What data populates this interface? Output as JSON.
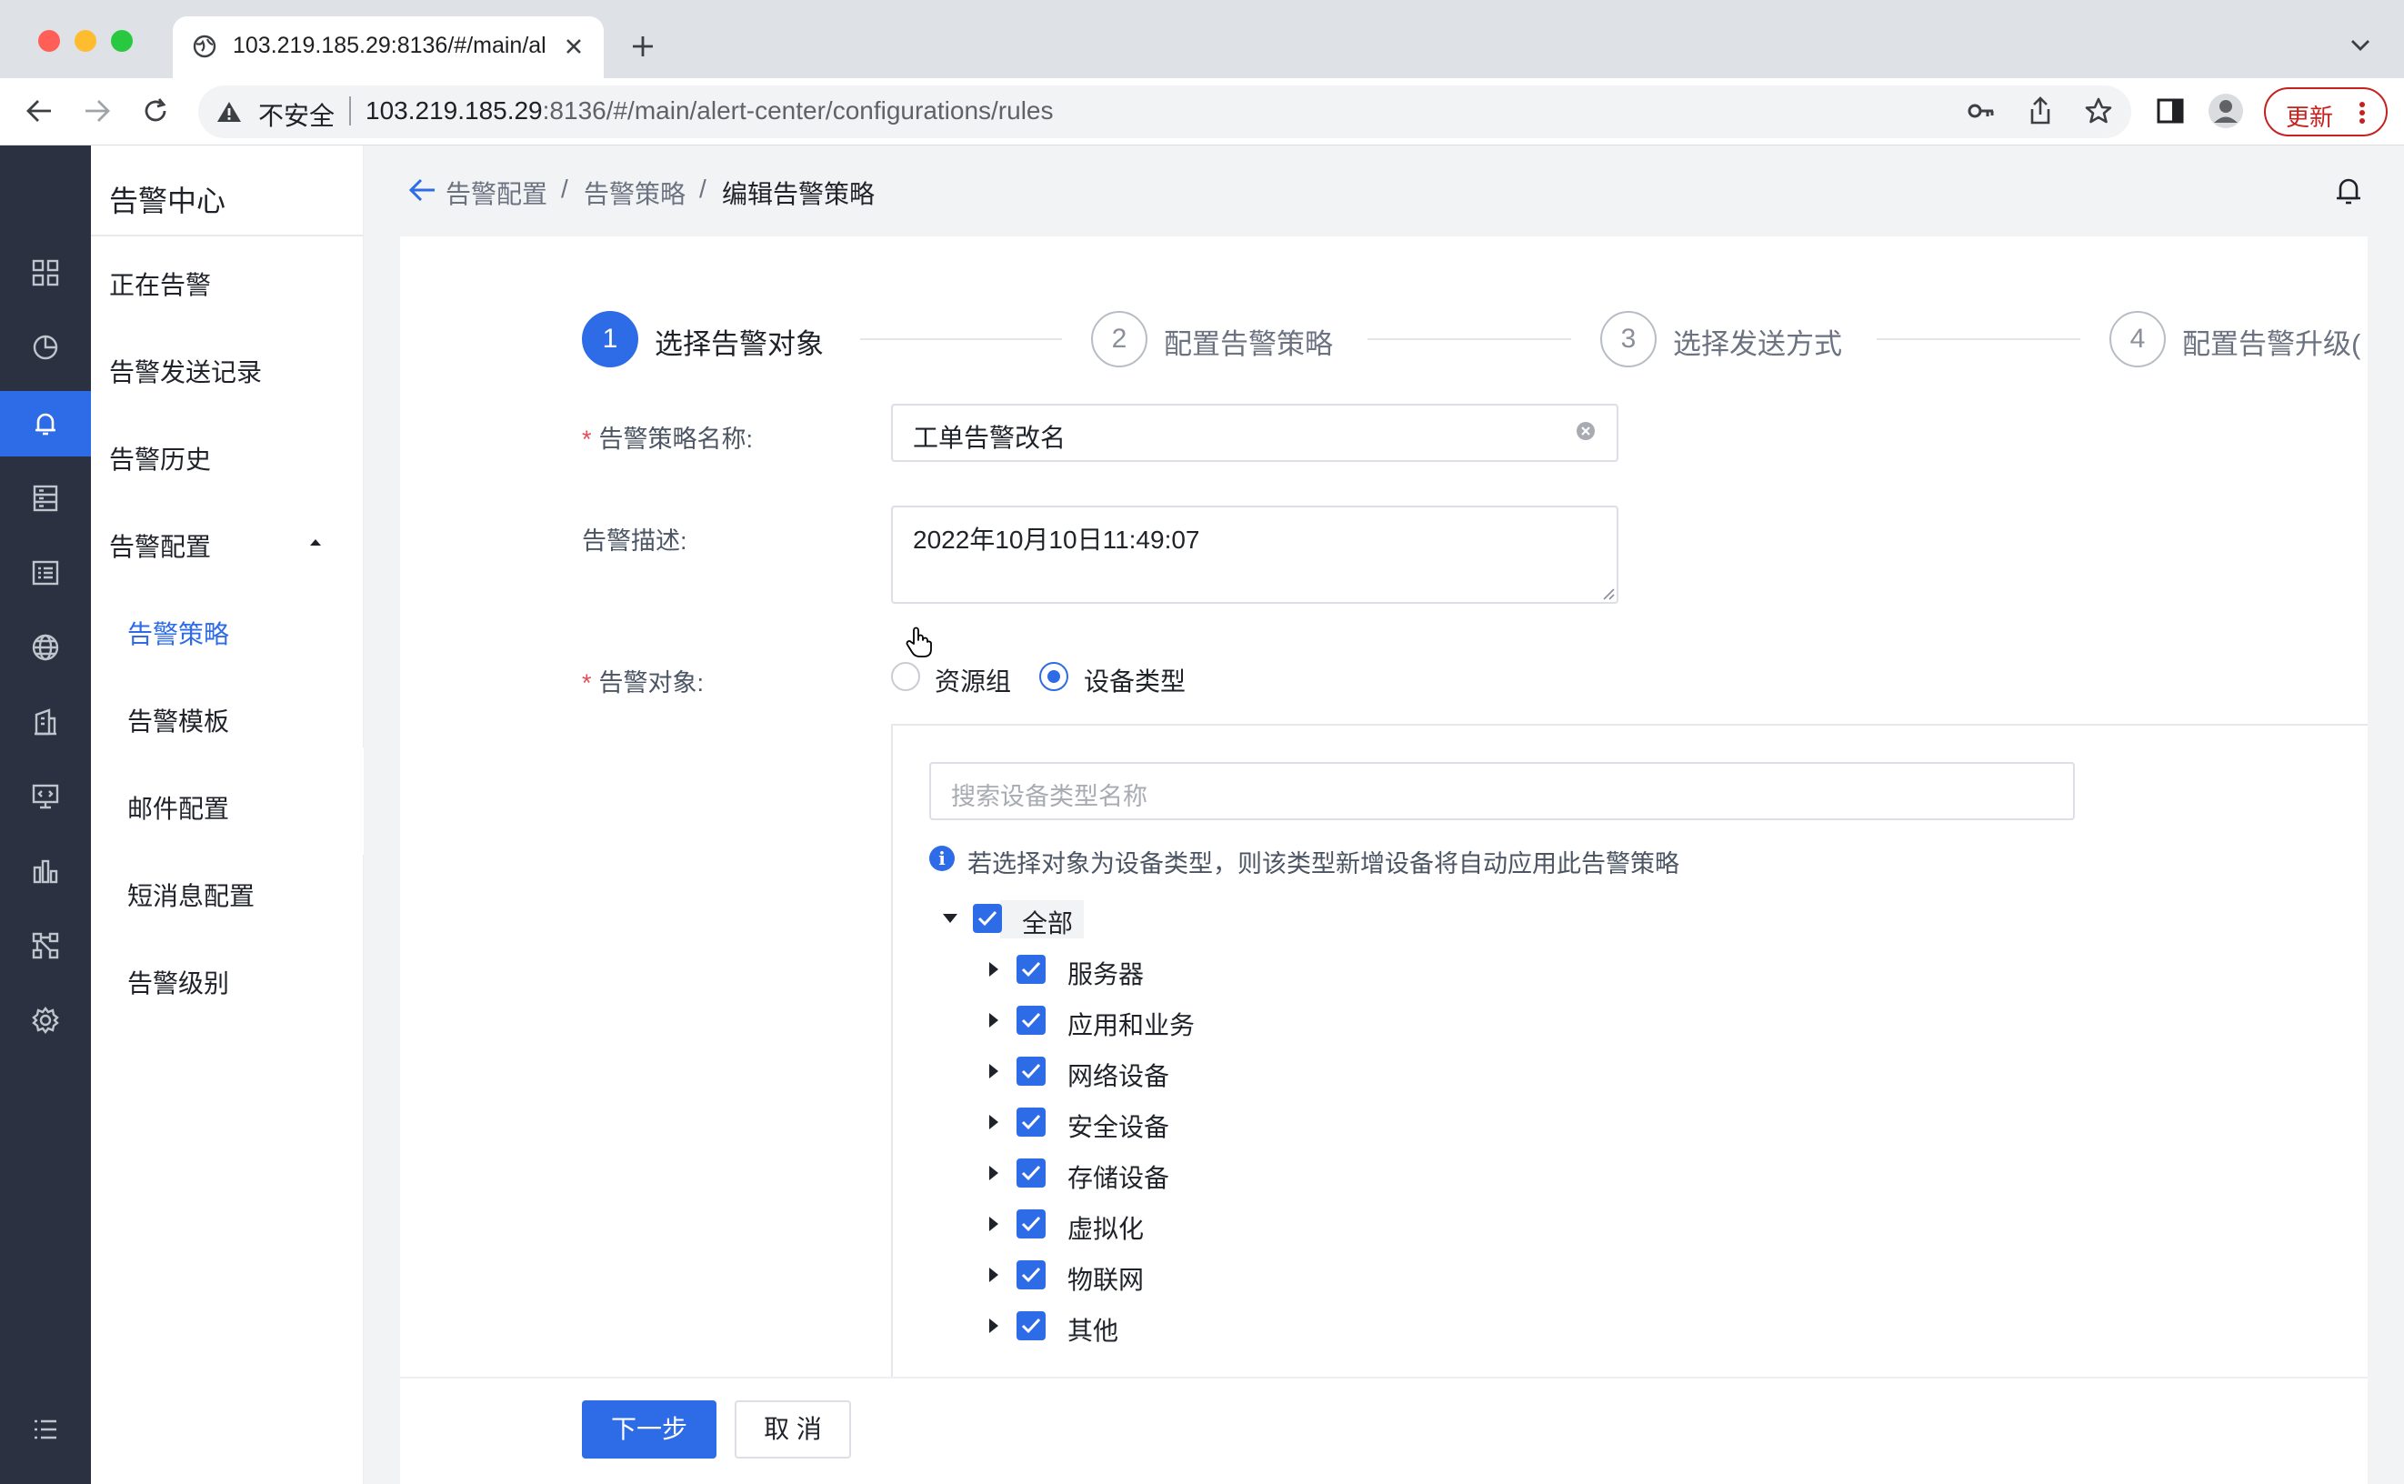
{
  "browser": {
    "tab_title": "103.219.185.29:8136/#/main/al",
    "security_label": "不安全",
    "url_host": "103.219.185.29",
    "url_rest": ":8136/#/main/alert-center/configurations/rules",
    "update_label": "更新"
  },
  "sidebar": {
    "title": "告警中心",
    "items": [
      {
        "label": "正在告警"
      },
      {
        "label": "告警发送记录"
      },
      {
        "label": "告警历史"
      },
      {
        "label": "告警配置"
      }
    ],
    "subitems": [
      {
        "label": "告警策略"
      },
      {
        "label": "告警模板"
      },
      {
        "label": "邮件配置"
      },
      {
        "label": "短消息配置"
      },
      {
        "label": "告警级别"
      }
    ]
  },
  "breadcrumb": {
    "level1": "告警配置",
    "sep1": "/",
    "level2": "告警策略",
    "sep2": "/",
    "current": "编辑告警策略"
  },
  "steps": [
    {
      "number": "1",
      "label": "选择告警对象"
    },
    {
      "number": "2",
      "label": "配置告警策略"
    },
    {
      "number": "3",
      "label": "选择发送方式"
    },
    {
      "number": "4",
      "label": "配置告警升级("
    }
  ],
  "form": {
    "required_mark": "*",
    "name_label": "告警策略名称:",
    "name_value": "工单告警改名",
    "desc_label": "告警描述:",
    "desc_value": "2022年10月10日11:49:07",
    "target_label": "告警对象:",
    "target_options": [
      {
        "label": "资源组",
        "checked": false
      },
      {
        "label": "设备类型",
        "checked": true
      }
    ],
    "search_placeholder": "搜索设备类型名称",
    "info_icon": "i",
    "info_text": "若选择对象为设备类型，则该类型新增设备将自动应用此告警策略",
    "tree_root": "全部",
    "tree_items": [
      {
        "label": "服务器"
      },
      {
        "label": "应用和业务"
      },
      {
        "label": "网络设备"
      },
      {
        "label": "安全设备"
      },
      {
        "label": "存储设备"
      },
      {
        "label": "虚拟化"
      },
      {
        "label": "物联网"
      },
      {
        "label": "其他"
      }
    ]
  },
  "actions": {
    "next_label": "下一步",
    "cancel_label": "取 消"
  },
  "colors": {
    "primary": "#2e6be6",
    "rail_bg": "#2b3140",
    "danger": "#e34d59"
  }
}
